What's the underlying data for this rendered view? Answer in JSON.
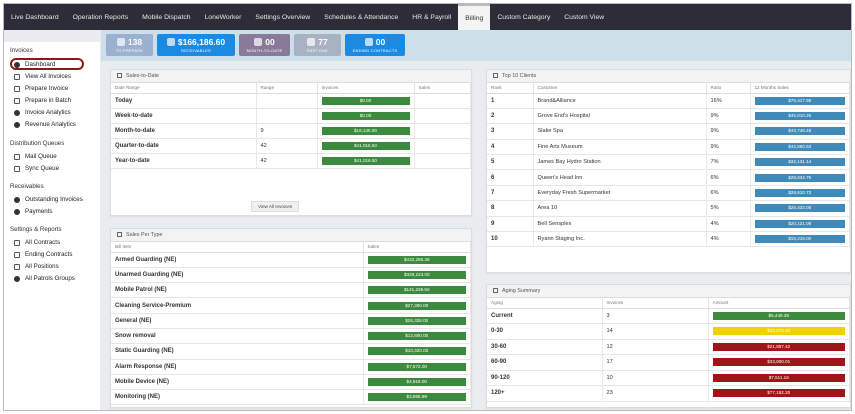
{
  "nav": [
    "Live Dashboard",
    "Operation Reports",
    "Mobile Dispatch",
    "LoneWorker",
    "Settings Overview",
    "Schedules & Attendance",
    "HR & Payroll",
    "Billing",
    "Custom Category",
    "Custom View"
  ],
  "active_tab": "Billing",
  "badges": [
    {
      "value": "138",
      "label": "TO PREPARE",
      "icon": "calendar-icon",
      "color": "#9cb0cf"
    },
    {
      "value": "$166,186.60",
      "label": "RECEIVABLES",
      "icon": "money-icon",
      "color": "#1b8ae2"
    },
    {
      "value": "00",
      "label": "MONTH-TO-DATE",
      "icon": "clock-icon",
      "color": "#8a7a99"
    },
    {
      "value": "77",
      "label": "PAST DUE",
      "icon": "warning-icon",
      "color": "#a8b2c2"
    },
    {
      "value": "00",
      "label": "ENDING CONTRACTS",
      "icon": "contract-icon",
      "color": "#1b8ae2"
    }
  ],
  "sidebar": {
    "invoices_title": "Invoices",
    "invoices": [
      "Dashboard",
      "View All Invoices",
      "Prepare Invoice",
      "Prepare in Batch",
      "Invoice Analytics",
      "Revenue Analytics"
    ],
    "distribution_title": "Distribution Queues",
    "distribution": [
      "Mail Queue",
      "Sync Queue"
    ],
    "receivables_title": "Receivables",
    "receivables": [
      "Outstanding Invoices",
      "Payments"
    ],
    "settings_title": "Settings & Reports",
    "settings": [
      "All Contracts",
      "Ending Contracts",
      "All Positions",
      "All Patrols Groups"
    ]
  },
  "sales_to_date": {
    "title": "Sales-to-Date",
    "headers": [
      "Date Range",
      "Range",
      "Invoices",
      "Sales"
    ],
    "rows": [
      {
        "label": "Today",
        "range": "",
        "invoices": "$0.00"
      },
      {
        "label": "Week-to-date",
        "range": "",
        "invoices": "$0.00"
      },
      {
        "label": "Month-to-date",
        "range": "9",
        "invoices": "$16,145.00"
      },
      {
        "label": "Quarter-to-date",
        "range": "42",
        "invoices": "$41,016.50"
      },
      {
        "label": "Year-to-date",
        "range": "42",
        "invoices": "$41,016.50"
      }
    ],
    "button": "View All Invoices"
  },
  "sales_per_type": {
    "title": "Sales Per Type",
    "headers": [
      "Bill Item",
      "Sales"
    ],
    "rows": [
      {
        "label": "Armed Guarding (NE)",
        "sales": "$432,286.38"
      },
      {
        "label": "Unarmed Guarding (NE)",
        "sales": "$328,223.00"
      },
      {
        "label": "Mobile Patrol (NE)",
        "sales": "$121,239.50"
      },
      {
        "label": "Cleaning Service-Premium",
        "sales": "$27,300.00"
      },
      {
        "label": "General (NE)",
        "sales": "$26,328.00"
      },
      {
        "label": "Snow removal",
        "sales": "$12,600.00"
      },
      {
        "label": "Static Guarding (NE)",
        "sales": "$10,320.00"
      },
      {
        "label": "Alarm Response (NE)",
        "sales": "$7,572.00"
      },
      {
        "label": "Mobile Device (NE)",
        "sales": "$4,918.00"
      },
      {
        "label": "Monitoring (NE)",
        "sales": "$3,865.99"
      }
    ]
  },
  "top_clients": {
    "title": "Top 10 Clients",
    "headers": [
      "Rank",
      "Customer",
      "Ratio",
      "12 Months Sales"
    ],
    "rows": [
      {
        "rank": "1",
        "customer": "Brand&Alliance",
        "ratio": "16%",
        "sales": "$75,417.99"
      },
      {
        "rank": "2",
        "customer": "Grove End's Hospital",
        "ratio": "9%",
        "sales": "$45,010.26"
      },
      {
        "rank": "3",
        "customer": "Slake Spa",
        "ratio": "9%",
        "sales": "$43,748.48"
      },
      {
        "rank": "4",
        "customer": "Fine Arts Museum",
        "ratio": "9%",
        "sales": "$42,880.53"
      },
      {
        "rank": "5",
        "customer": "James Bay Hydro Station",
        "ratio": "7%",
        "sales": "$32,131.14"
      },
      {
        "rank": "6",
        "customer": "Queen's Head Inn",
        "ratio": "6%",
        "sales": "$28,634.76"
      },
      {
        "rank": "7",
        "customer": "Everyday Fresh Supermarket",
        "ratio": "6%",
        "sales": "$28,610.73"
      },
      {
        "rank": "8",
        "customer": "Area 10",
        "ratio": "5%",
        "sales": "$25,433.08"
      },
      {
        "rank": "9",
        "customer": "Bell Sensplex",
        "ratio": "4%",
        "sales": "$20,121.09"
      },
      {
        "rank": "10",
        "customer": "Ryann Staging Inc.",
        "ratio": "4%",
        "sales": "$16,219.00"
      }
    ]
  },
  "aging": {
    "title": "Aging Summary",
    "headers": [
      "Aging",
      "Invoices",
      "Amount"
    ],
    "rows": [
      {
        "label": "Current",
        "invoices": "3",
        "amount": "$5,449.28",
        "color": "#3b8a3e"
      },
      {
        "label": "0-30",
        "invoices": "14",
        "amount": "$30,578.40",
        "color": "#f1d100"
      },
      {
        "label": "30-60",
        "invoices": "12",
        "amount": "$21,887.42",
        "color": "#a01517"
      },
      {
        "label": "60-90",
        "invoices": "17",
        "amount": "$33,600.01",
        "color": "#a01517"
      },
      {
        "label": "90-120",
        "invoices": "10",
        "amount": "$7,511.16",
        "color": "#a01517"
      },
      {
        "label": "120+",
        "invoices": "23",
        "amount": "$77,162.20",
        "color": "#a01517"
      }
    ]
  }
}
